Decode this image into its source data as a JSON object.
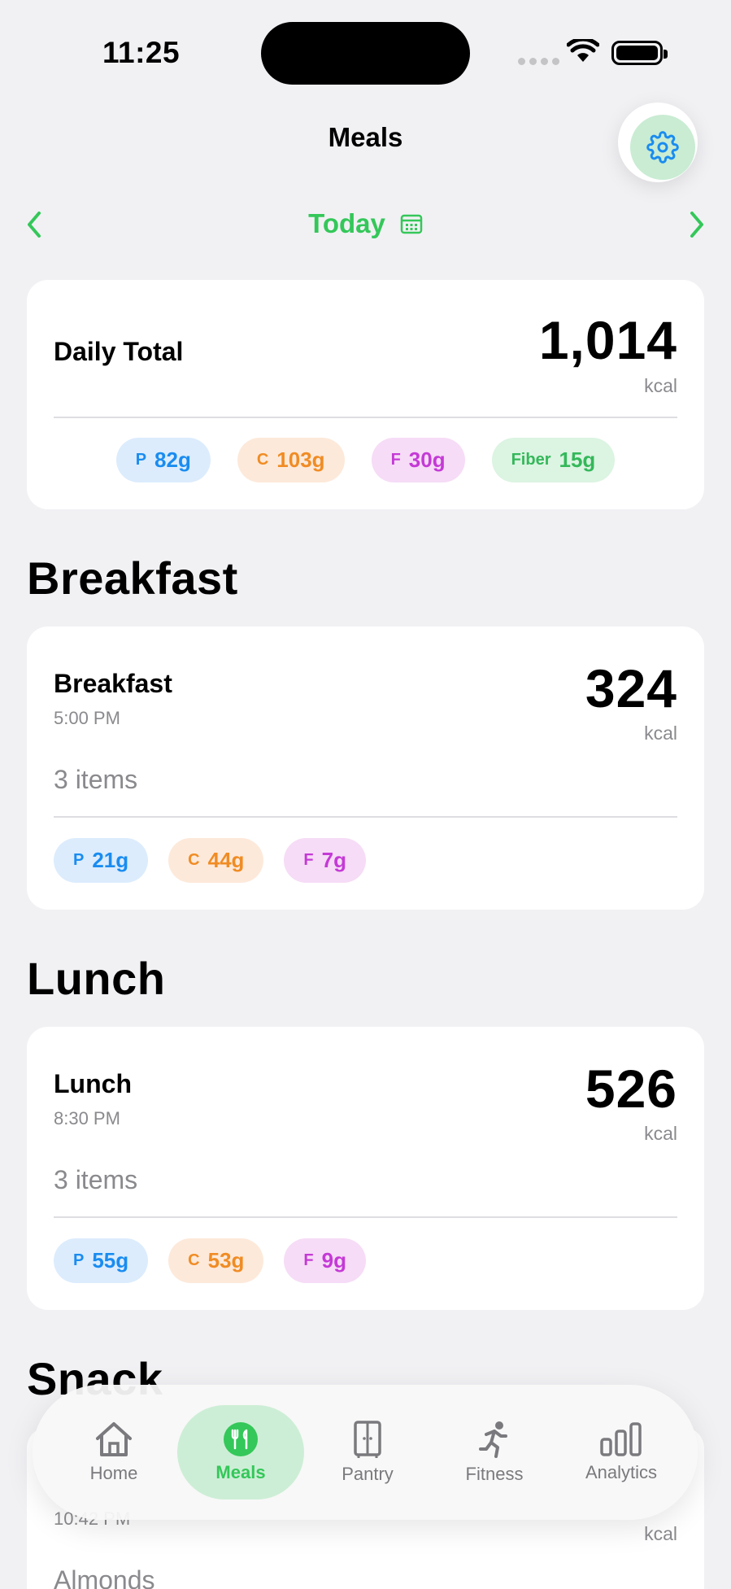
{
  "status": {
    "time": "11:25"
  },
  "nav": {
    "title": "Meals",
    "date_label": "Today"
  },
  "daily_total": {
    "title": "Daily Total",
    "kcal": "1,014",
    "unit": "kcal",
    "macros": [
      {
        "key": "P",
        "value": "82g"
      },
      {
        "key": "C",
        "value": "103g"
      },
      {
        "key": "F",
        "value": "30g"
      },
      {
        "key": "Fiber",
        "value": "15g"
      }
    ]
  },
  "sections": [
    {
      "header": "Breakfast",
      "meal": {
        "name": "Breakfast",
        "time": "5:00 PM",
        "kcal": "324",
        "unit": "kcal",
        "items": "3 items",
        "macros": [
          {
            "key": "P",
            "value": "21g"
          },
          {
            "key": "C",
            "value": "44g"
          },
          {
            "key": "F",
            "value": "7g"
          }
        ]
      }
    },
    {
      "header": "Lunch",
      "meal": {
        "name": "Lunch",
        "time": "8:30 PM",
        "kcal": "526",
        "unit": "kcal",
        "items": "3 items",
        "macros": [
          {
            "key": "P",
            "value": "55g"
          },
          {
            "key": "C",
            "value": "53g"
          },
          {
            "key": "F",
            "value": "9g"
          }
        ]
      }
    },
    {
      "header": "Snack",
      "meal": {
        "time": "10:42 PM",
        "unit": "kcal",
        "items": "Almonds"
      }
    }
  ],
  "tabs": [
    {
      "label": "Home",
      "icon": "home-icon"
    },
    {
      "label": "Meals",
      "icon": "fork-knife-icon",
      "active": true
    },
    {
      "label": "Pantry",
      "icon": "pantry-icon"
    },
    {
      "label": "Fitness",
      "icon": "running-icon"
    },
    {
      "label": "Analytics",
      "icon": "bar-chart-icon"
    }
  ],
  "colors": {
    "accent": "#34c759",
    "protein": "#1a8cf0",
    "carbs": "#f08c24",
    "fat": "#c43ad6",
    "fiber": "#34b85a"
  }
}
